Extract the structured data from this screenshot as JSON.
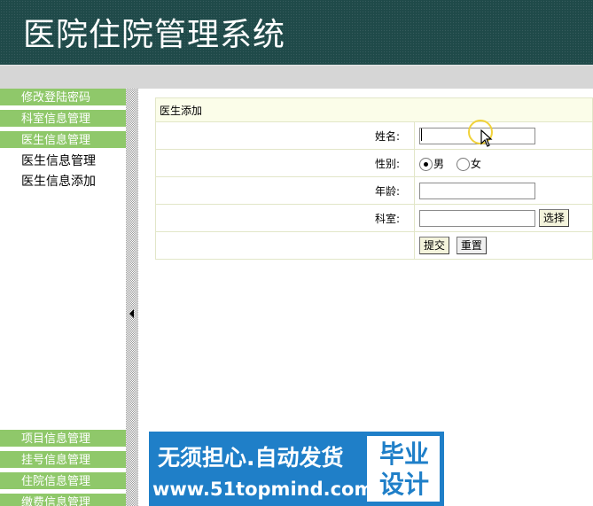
{
  "header": {
    "title": "医院住院管理系统"
  },
  "sidebar": {
    "menus_top": [
      {
        "label": "修改登陆密码"
      },
      {
        "label": "科室信息管理"
      },
      {
        "label": "医生信息管理"
      }
    ],
    "sub_items": [
      {
        "label": "医生信息管理"
      },
      {
        "label": "医生信息添加"
      }
    ],
    "menus_bottom": [
      {
        "label": "项目信息管理"
      },
      {
        "label": "挂号信息管理"
      },
      {
        "label": "住院信息管理"
      },
      {
        "label": "缴费信息管理"
      }
    ]
  },
  "form": {
    "title": "医生添加",
    "name_label": "姓名:",
    "name_value": "",
    "gender_label": "性别:",
    "gender_options": [
      {
        "label": "男",
        "checked": true
      },
      {
        "label": "女",
        "checked": false
      }
    ],
    "age_label": "年龄:",
    "age_value": "",
    "dept_label": "科室:",
    "dept_value": "",
    "select_button": "选择",
    "submit_button": "提交",
    "reset_button": "重置"
  },
  "banner": {
    "line1": "无须担心.自动发货",
    "line2": "www.51topmind.com",
    "right_top": "毕业",
    "right_bottom": "设计"
  },
  "colors": {
    "header_bg": "#1f4a49",
    "menu_bg": "#8fc86a",
    "banner_bg": "#1f7fc8",
    "form_title_bg": "#fbfde9"
  }
}
